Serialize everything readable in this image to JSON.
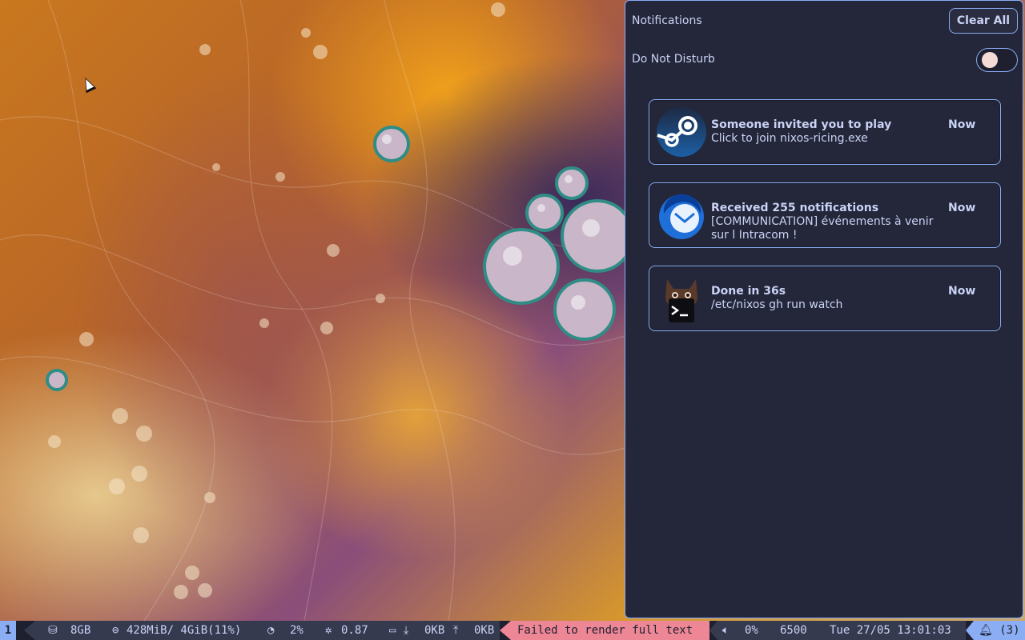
{
  "notification_center": {
    "header": "Notifications",
    "clear_all_label": "Clear All",
    "dnd_label": "Do Not Disturb",
    "dnd_enabled": false,
    "notifications": [
      {
        "app_icon": "steam-icon",
        "title": "Someone invited you to play",
        "body": "Click to join nixos-ricing.exe",
        "time": "Now"
      },
      {
        "app_icon": "thunderbird-icon",
        "title": "Received 255 notifications",
        "body": "[COMMUNICATION] événements à venir sur l Intracom !",
        "time": "Now"
      },
      {
        "app_icon": "terminal-cat-icon",
        "title": "Done in 36s",
        "body": "/etc/nixos gh run watch",
        "time": "Now"
      }
    ]
  },
  "statusbar": {
    "workspace": "1",
    "disk": "8GB",
    "memory": "428MiB/ 4GiB(11%)",
    "cpu": "2%",
    "load": "0.87",
    "net_down": "0KB",
    "net_up": "0KB",
    "error_text": "Failed to render full text",
    "volume": "0%",
    "brightness": "6500",
    "clock": "Tue 27/05 13:01:03",
    "notification_count": "(3)"
  },
  "colors": {
    "accent": "#8aadf4",
    "panel_bg": "#24273a",
    "text": "#cad3f5",
    "error": "#ed8796"
  }
}
